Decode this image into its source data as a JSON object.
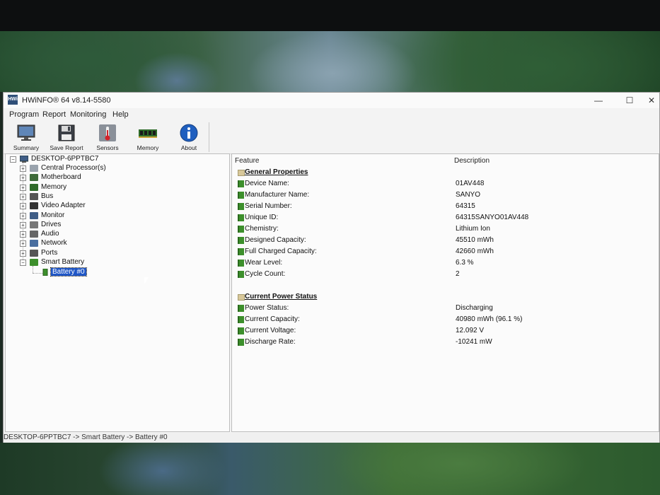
{
  "window": {
    "title": "HWiNFO® 64 v8.14-5580",
    "app_icon_text": "HWi",
    "controls": {
      "minimize": "—",
      "maximize": "☐",
      "close": "✕"
    }
  },
  "menu": [
    "Program",
    "Report",
    "Monitoring",
    "Help"
  ],
  "toolbar": [
    {
      "label": "Summary",
      "icon": "monitor-icon"
    },
    {
      "label": "Save Report",
      "icon": "floppy-disk-icon"
    },
    {
      "label": "Sensors",
      "icon": "thermometer-icon"
    },
    {
      "label": "Memory",
      "icon": "memory-module-icon"
    },
    {
      "label": "About",
      "icon": "info-icon"
    }
  ],
  "tree": {
    "root": "DESKTOP-6PPTBC7",
    "items": [
      {
        "label": "Central Processor(s)",
        "icon": "cpu-icon"
      },
      {
        "label": "Motherboard",
        "icon": "motherboard-icon"
      },
      {
        "label": "Memory",
        "icon": "memory-icon"
      },
      {
        "label": "Bus",
        "icon": "bus-icon"
      },
      {
        "label": "Video Adapter",
        "icon": "video-adapter-icon"
      },
      {
        "label": "Monitor",
        "icon": "monitor-icon"
      },
      {
        "label": "Drives",
        "icon": "drives-icon"
      },
      {
        "label": "Audio",
        "icon": "audio-icon"
      },
      {
        "label": "Network",
        "icon": "network-icon"
      },
      {
        "label": "Ports",
        "icon": "ports-icon"
      },
      {
        "label": "Smart Battery",
        "icon": "battery-icon"
      }
    ],
    "child": "Battery #0"
  },
  "details": {
    "col_feature": "Feature",
    "col_description": "Description",
    "sections": [
      {
        "title": "General Properties",
        "rows": [
          {
            "feature": "Device Name:",
            "value": "01AV448"
          },
          {
            "feature": "Manufacturer Name:",
            "value": "SANYO"
          },
          {
            "feature": "Serial Number:",
            "value": "64315"
          },
          {
            "feature": "Unique ID:",
            "value": "64315SANYO01AV448"
          },
          {
            "feature": "Chemistry:",
            "value": "Lithium Ion"
          },
          {
            "feature": "Designed Capacity:",
            "value": "45510 mWh"
          },
          {
            "feature": "Full Charged Capacity:",
            "value": "42660 mWh"
          },
          {
            "feature": "Wear Level:",
            "value": "6.3 %"
          },
          {
            "feature": "Cycle Count:",
            "value": "2"
          }
        ]
      },
      {
        "title": "Current Power Status",
        "rows": [
          {
            "feature": "Power Status:",
            "value": "Discharging"
          },
          {
            "feature": "Current Capacity:",
            "value": "40980 mWh (96.1 %)"
          },
          {
            "feature": "Current Voltage:",
            "value": "12.092 V"
          },
          {
            "feature": "Discharge Rate:",
            "value": "-10241 mW"
          }
        ]
      }
    ]
  },
  "status": "DESKTOP-6PPTBC7 -> Smart Battery -> Battery #0"
}
